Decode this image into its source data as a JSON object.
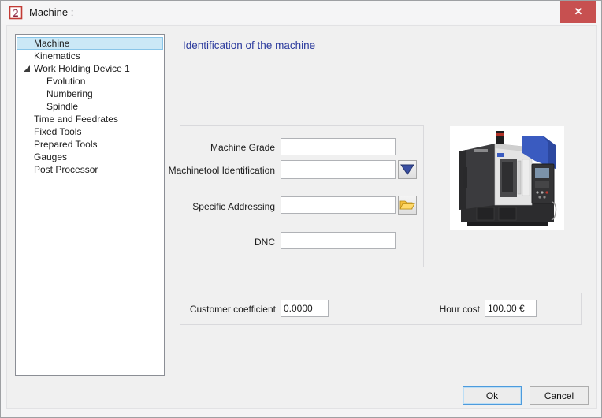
{
  "window": {
    "title": "Machine :",
    "close_label": "✕",
    "app_icon": "brand-2-logo"
  },
  "sidebar": {
    "items": [
      {
        "label": "Machine",
        "level": 0,
        "selected": true,
        "expander": false
      },
      {
        "label": "Kinematics",
        "level": 0,
        "selected": false,
        "expander": false
      },
      {
        "label": "Work Holding Device 1",
        "level": 0,
        "selected": false,
        "expander": true
      },
      {
        "label": "Evolution",
        "level": 1,
        "selected": false,
        "expander": false
      },
      {
        "label": "Numbering",
        "level": 1,
        "selected": false,
        "expander": false
      },
      {
        "label": "Spindle",
        "level": 1,
        "selected": false,
        "expander": false
      },
      {
        "label": "Time and Feedrates",
        "level": 0,
        "selected": false,
        "expander": false
      },
      {
        "label": "Fixed Tools",
        "level": 0,
        "selected": false,
        "expander": false
      },
      {
        "label": "Prepared Tools",
        "level": 0,
        "selected": false,
        "expander": false
      },
      {
        "label": "Gauges",
        "level": 0,
        "selected": false,
        "expander": false
      },
      {
        "label": "Post Processor",
        "level": 0,
        "selected": false,
        "expander": false
      }
    ]
  },
  "main": {
    "heading": "Identification of the machine",
    "fields": {
      "machine_grade": {
        "label": "Machine Grade",
        "value": ""
      },
      "machinetool_identification": {
        "label": "Machinetool Identification",
        "value": "",
        "button_icon": "dropdown-icon"
      },
      "specific_addressing": {
        "label": "Specific Addressing",
        "value": "",
        "button_icon": "folder-open-icon"
      },
      "dnc": {
        "label": "DNC",
        "value": ""
      }
    },
    "coefficients": {
      "customer_coefficient": {
        "label": "Customer coefficient",
        "value": "0.0000"
      },
      "hour_cost": {
        "label": "Hour cost",
        "value": "100.00 €"
      }
    },
    "photo": "cnc-machining-center"
  },
  "footer": {
    "ok_label": "Ok",
    "cancel_label": "Cancel"
  },
  "colors": {
    "close_button": "#c75050",
    "heading_blue": "#2b3a9d",
    "tree_selection": "#cbe8f6",
    "dropdown_triangle": "#3a4fa2",
    "folder_yellow": "#ffd34e",
    "machine_blue": "#3a5bc0"
  }
}
